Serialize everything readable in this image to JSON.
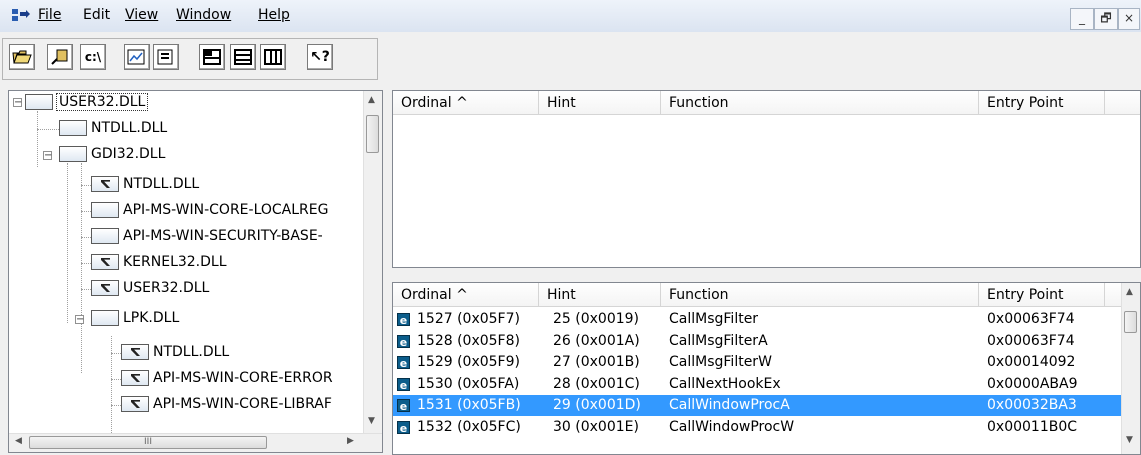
{
  "menu": {
    "items": [
      "File",
      "Edit",
      "View",
      "Window",
      "Help"
    ]
  },
  "window_controls": {
    "minimize": "_",
    "restore": "🗗",
    "close": "×"
  },
  "toolbar": {
    "buttons": [
      "open-icon",
      "save-icon",
      "command-prompt-icon",
      "properties-icon",
      "module-list-icon",
      "layout-horizontal-icon",
      "layout-split-icon",
      "layout-columns-icon",
      "help-icon"
    ],
    "cmd_label": "c:\\",
    "help_label": "?"
  },
  "tree": {
    "nodes": [
      {
        "label": "USER32.DLL"
      },
      {
        "label": "NTDLL.DLL"
      },
      {
        "label": "GDI32.DLL"
      },
      {
        "label": "NTDLL.DLL"
      },
      {
        "label": "API-MS-WIN-CORE-LOCALREG"
      },
      {
        "label": "API-MS-WIN-SECURITY-BASE-"
      },
      {
        "label": "KERNEL32.DLL"
      },
      {
        "label": "USER32.DLL"
      },
      {
        "label": "LPK.DLL"
      },
      {
        "label": "NTDLL.DLL"
      },
      {
        "label": "API-MS-WIN-CORE-ERROR"
      },
      {
        "label": "API-MS-WIN-CORE-LIBRAF"
      }
    ],
    "hscroll_grip": "III"
  },
  "imports": {
    "headers": [
      "Ordinal ^",
      "Hint",
      "Function",
      "Entry Point"
    ]
  },
  "exports": {
    "headers": [
      "Ordinal ^",
      "Hint",
      "Function",
      "Entry Point"
    ],
    "rows": [
      {
        "ordinal": "1527  (0x05F7)",
        "hint": "25  (0x0019)",
        "function": "CallMsgFilter",
        "entry": "0x00063F74",
        "selected": false
      },
      {
        "ordinal": "1528  (0x05F8)",
        "hint": "26  (0x001A)",
        "function": "CallMsgFilterA",
        "entry": "0x00063F74",
        "selected": false
      },
      {
        "ordinal": "1529  (0x05F9)",
        "hint": "27  (0x001B)",
        "function": "CallMsgFilterW",
        "entry": "0x00014092",
        "selected": false
      },
      {
        "ordinal": "1530  (0x05FA)",
        "hint": "28  (0x001C)",
        "function": "CallNextHookEx",
        "entry": "0x0000ABA9",
        "selected": false
      },
      {
        "ordinal": "1531  (0x05FB)",
        "hint": "29  (0x001D)",
        "function": "CallWindowProcA",
        "entry": "0x00032BA3",
        "selected": true
      },
      {
        "ordinal": "1532  (0x05FC)",
        "hint": "30  (0x001E)",
        "function": "CallWindowProcW",
        "entry": "0x00011B0C",
        "selected": false
      }
    ],
    "icon_letter": "e"
  },
  "colors": {
    "selection": "#3399ff",
    "export_icon": "#0b5d8b"
  }
}
